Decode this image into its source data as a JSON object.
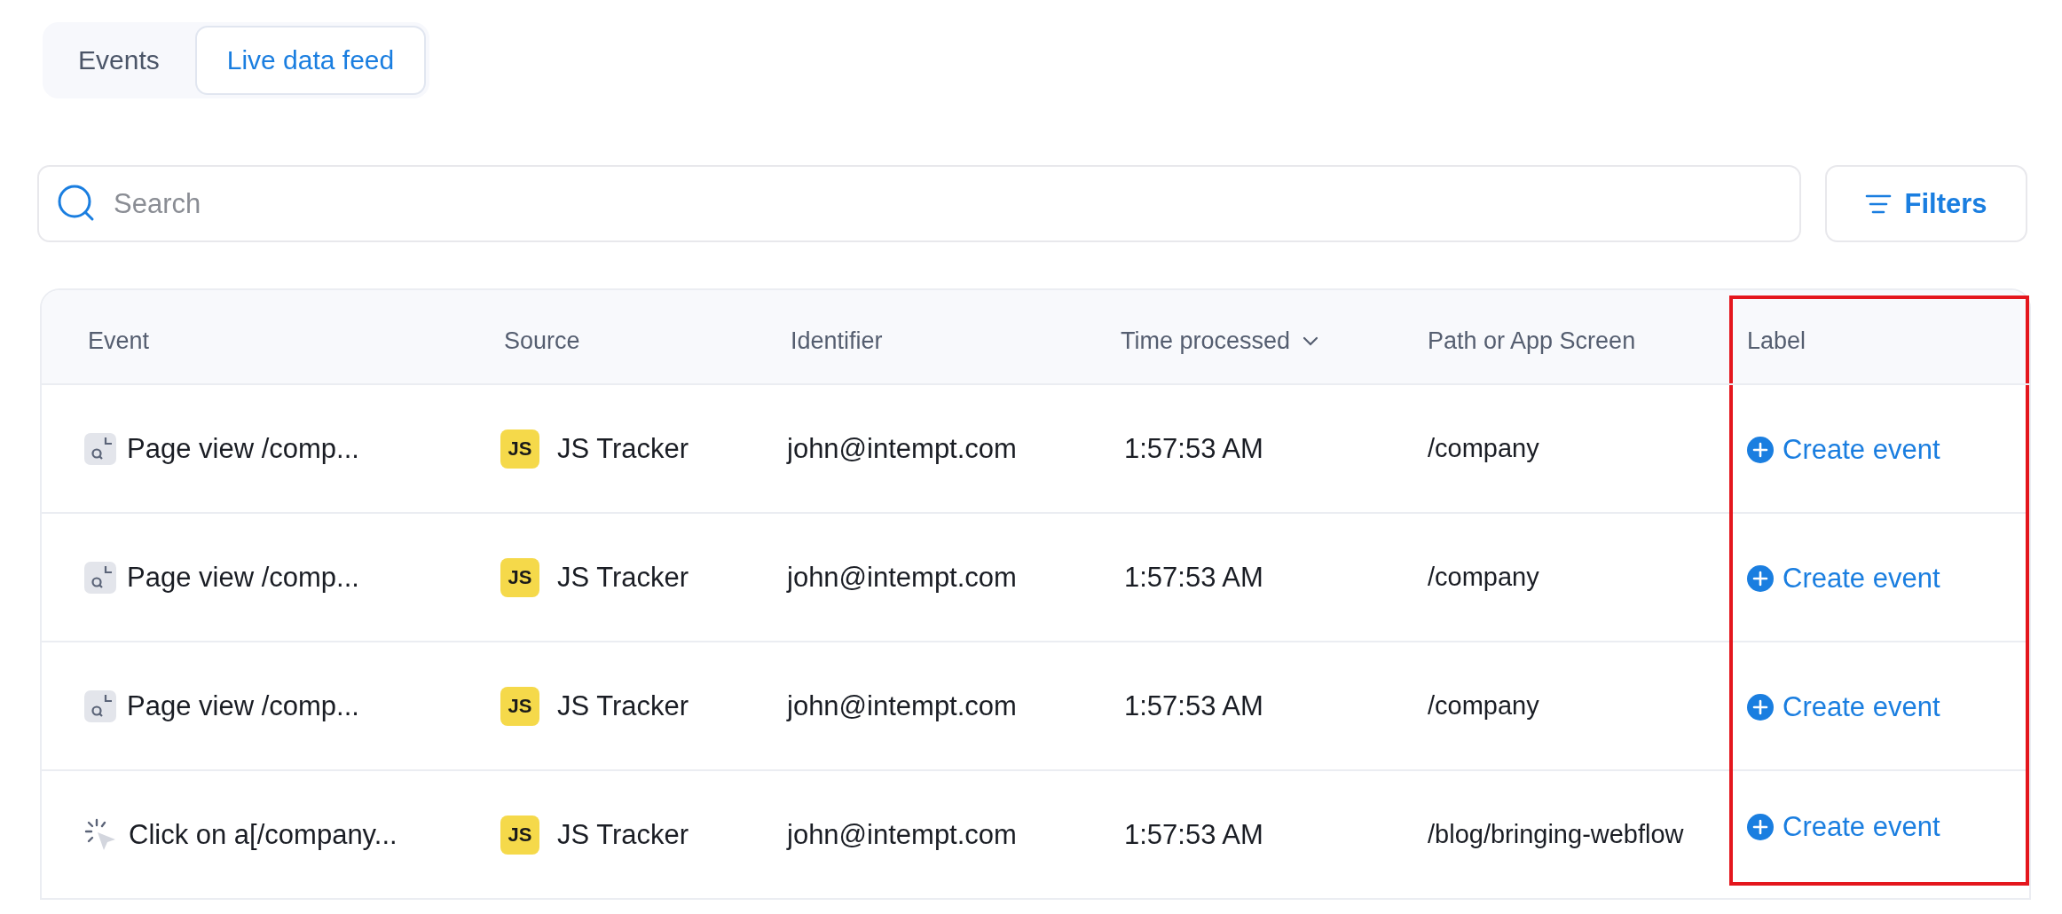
{
  "tabs": [
    {
      "label": "Events",
      "selected": false
    },
    {
      "label": "Live data feed",
      "selected": true
    }
  ],
  "search": {
    "placeholder": "Search"
  },
  "filters_button": {
    "label": "Filters"
  },
  "table": {
    "columns": [
      {
        "label": "Event",
        "sorted": false,
        "highlighted": false
      },
      {
        "label": "Source",
        "sorted": false,
        "highlighted": false
      },
      {
        "label": "Identifier",
        "sorted": false,
        "highlighted": false
      },
      {
        "label": "Time processed",
        "sorted": true,
        "highlighted": false
      },
      {
        "label": "Path or App Screen",
        "sorted": false,
        "highlighted": false
      },
      {
        "label": "Label",
        "sorted": false,
        "highlighted": true
      }
    ],
    "rows": [
      {
        "event": "Page view /comp...",
        "kind": "page_view",
        "source_badge": "JS",
        "source": "JS Tracker",
        "identifier": "john@intempt.com",
        "time": "1:57:53 AM",
        "path": "/company",
        "action": "Create event"
      },
      {
        "event": "Page view /comp...",
        "kind": "page_view",
        "source_badge": "JS",
        "source": "JS Tracker",
        "identifier": "john@intempt.com",
        "time": "1:57:53 AM",
        "path": "/company",
        "action": "Create event"
      },
      {
        "event": "Page view /comp...",
        "kind": "page_view",
        "source_badge": "JS",
        "source": "JS Tracker",
        "identifier": "john@intempt.com",
        "time": "1:57:53 AM",
        "path": "/company",
        "action": "Create event"
      },
      {
        "event": "Click on a[/company...",
        "kind": "click",
        "source_badge": "JS",
        "source": "JS Tracker",
        "identifier": "john@intempt.com",
        "time": "1:57:53 AM",
        "path": "/blog/bringing-webflow",
        "action": "Create event"
      }
    ]
  }
}
